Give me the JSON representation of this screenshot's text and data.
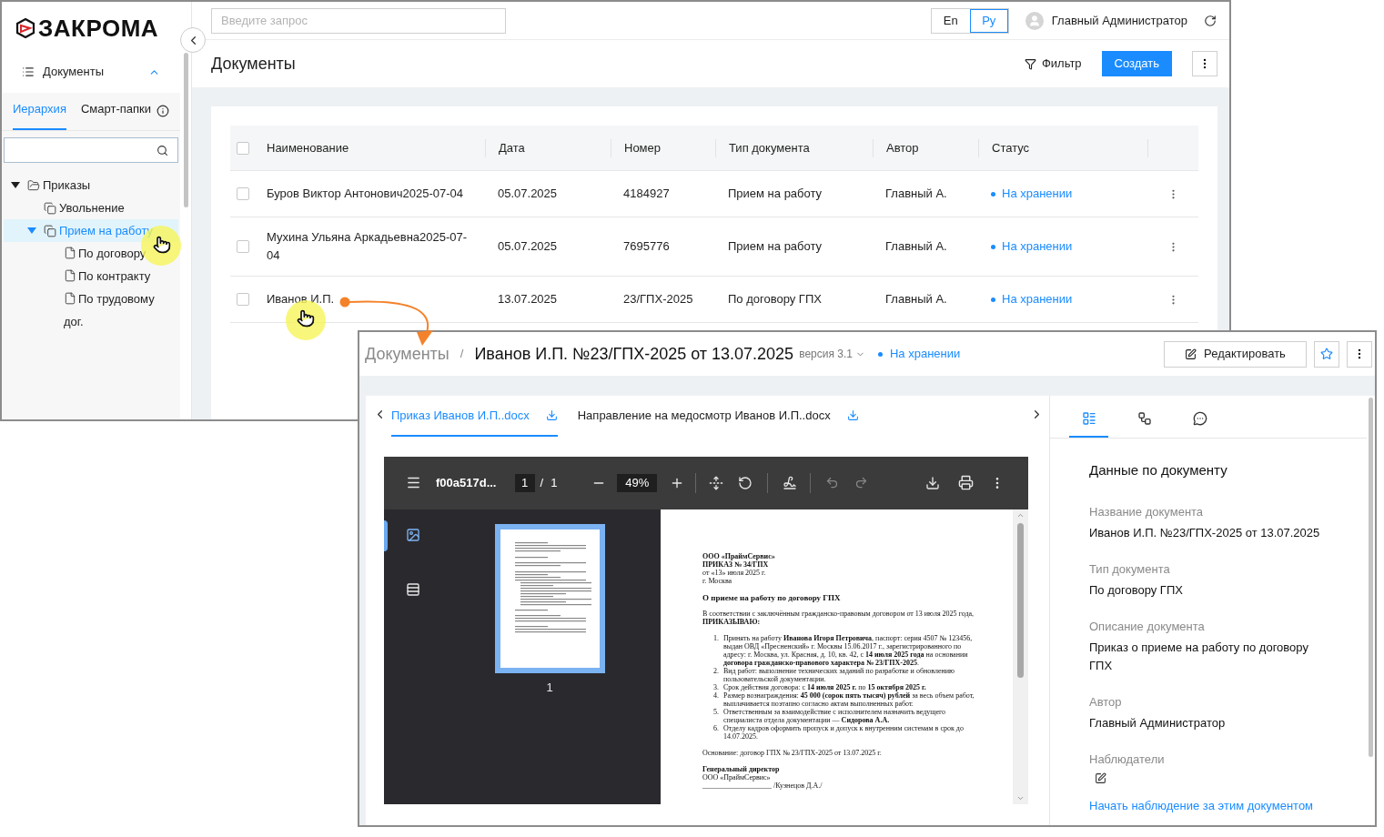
{
  "main_window": {
    "logo": "ЗАКРОМА",
    "search": {
      "placeholder": "Введите запрос"
    },
    "languages": [
      {
        "label": "En",
        "selected": false
      },
      {
        "label": "Ру",
        "selected": true
      }
    ],
    "user": "Главный Администратор",
    "sidebar": {
      "section": {
        "label": "Документы",
        "expanded": true
      },
      "tabs": [
        {
          "label": "Иерархия",
          "selected": true
        },
        {
          "label": "Смарт-папки",
          "selected": false
        }
      ],
      "tree": [
        {
          "label": "Приказы",
          "kind": "folder",
          "expanded": true,
          "selected": false,
          "children": [
            {
              "label": "Увольнение",
              "kind": "group",
              "selected": false
            },
            {
              "label": "Прием на работу",
              "kind": "group",
              "expanded": true,
              "selected": true,
              "children": [
                {
                  "label": "По договору",
                  "kind": "file",
                  "selected": false
                },
                {
                  "label": "По контракту",
                  "kind": "file",
                  "selected": false
                },
                {
                  "label": "По трудовому дог.",
                  "kind": "file",
                  "selected": false
                }
              ]
            }
          ]
        }
      ]
    },
    "page_title": "Документы",
    "filter_button": "Фильтр",
    "create_button": "Создать",
    "table": {
      "all_checked": false,
      "columns": [
        "Наименование",
        "Дата",
        "Номер",
        "Тип документа",
        "Автор",
        "Статус"
      ],
      "rows": [
        {
          "checked": false,
          "cells": [
            "Буров Виктор Антонович2025-07-04",
            "05.07.2025",
            "4184927",
            "Прием на работу",
            "Главный А."
          ],
          "status": "На хранении"
        },
        {
          "checked": false,
          "cells": [
            "Мухина Ульяна Аркадьевна2025-07-04",
            "05.07.2025",
            "7695776",
            "Прием на работу",
            "Главный А."
          ],
          "status": "На хранении"
        },
        {
          "checked": false,
          "cells": [
            "Иванов И.П.",
            "13.07.2025",
            "23/ГПХ-2025",
            "По договору ГПХ",
            "Главный А."
          ],
          "status": "На хранении"
        }
      ]
    }
  },
  "document_window": {
    "breadcrumb": "Документы",
    "separator": "/",
    "title": "Иванов И.П. №23/ГПХ-2025 от 13.07.2025",
    "version": "версия 3.1",
    "status": "На хранении",
    "edit_button": "Редактировать",
    "files": [
      {
        "label": "Приказ Иванов И.П..docx",
        "selected": true
      },
      {
        "label": "Направление на медосмотр Иванов И.П..docx",
        "selected": false
      }
    ],
    "viewer": {
      "file_name": "f00a517d...",
      "page": "1",
      "page_separator": "/",
      "page_count": "1",
      "zoom": "49%",
      "sidebar_views": [
        {
          "kind": "thumbnails",
          "selected": true
        },
        {
          "kind": "outline",
          "selected": false
        }
      ],
      "thumbnails": [
        {
          "label": "1",
          "selected": true
        }
      ],
      "document": {
        "header": [
          {
            "text": "ООО «ПраймСервис»",
            "bold": true
          },
          {
            "text": "ПРИКАЗ № 34/ГПХ",
            "bold": true
          },
          {
            "text": "от «13» июля 2025 г.",
            "bold": false
          },
          {
            "text": "г. Москва",
            "bold": false
          }
        ],
        "title": "О приеме на работу по договору ГПХ",
        "intro": "В соответствии с заключённым гражданско-правовым договором от 13 июля 2025 года,",
        "order": "ПРИКАЗЫВАЮ:",
        "items": [
          {
            "number": "1.",
            "text": "Принять на работу **Иванова Игоря Петровича**, паспорт: серия 4507 № 123456, выдан ОВД «Пресненский» г. Москвы 15.06.2017 г., зарегистрированного по адресу: г. Москва, ул. Красная, д. 10, кв. 42, с **14 июля 2025 года** на основании **договора гражданско-правового характера № 23/ГПХ-2025**."
          },
          {
            "number": "2.",
            "text": "Вид работ: выполнение технических заданий по разработке и обновлению пользовательской документации."
          },
          {
            "number": "3.",
            "text": "Срок действия договора: с **14 июля 2025 г.** по **15 октября 2025 г.**"
          },
          {
            "number": "4.",
            "text": "Размер вознаграждения: **45 000 (сорок пять тысяч) рублей** за весь объем работ, выплачивается поэтапно согласно актам выполненных работ."
          },
          {
            "number": "5.",
            "text": "Ответственным за взаимодействие с исполнителем назначить ведущего специалиста отдела документации — **Сидорова А.А.**"
          },
          {
            "number": "6.",
            "text": "Отделу кадров оформить пропуск и допуск к внутренним системам в срок до 14.07.2025."
          }
        ],
        "basis": "Основание: договор ГПХ № 23/ГПХ-2025 от 13.07.2025 г.",
        "signature": [
          {
            "text": "Генеральный директор",
            "bold": true
          },
          {
            "text": "ООО «ПраймСервис»",
            "bold": false
          },
          {
            "text": "___________________ /Кузнецов Д.А./",
            "bold": false
          }
        ]
      }
    },
    "panel_tabs": [
      {
        "kind": "details",
        "selected": true
      },
      {
        "kind": "structure",
        "selected": false
      },
      {
        "kind": "comments",
        "selected": false
      }
    ],
    "panel_title": "Данные по документу",
    "fields": [
      {
        "label": "Название документа",
        "value": "Иванов И.П. №23/ГПХ-2025 от 13.07.2025"
      },
      {
        "label": "Тип документа",
        "value": "По договору ГПХ"
      },
      {
        "label": "Описание документа",
        "value": "Приказ о приеме на работу по договору ГПХ"
      },
      {
        "label": "Автор",
        "value": "Главный Администратор"
      }
    ],
    "observers_label": "Наблюдатели",
    "watch_link": "Начать наблюдение за этим документом"
  }
}
